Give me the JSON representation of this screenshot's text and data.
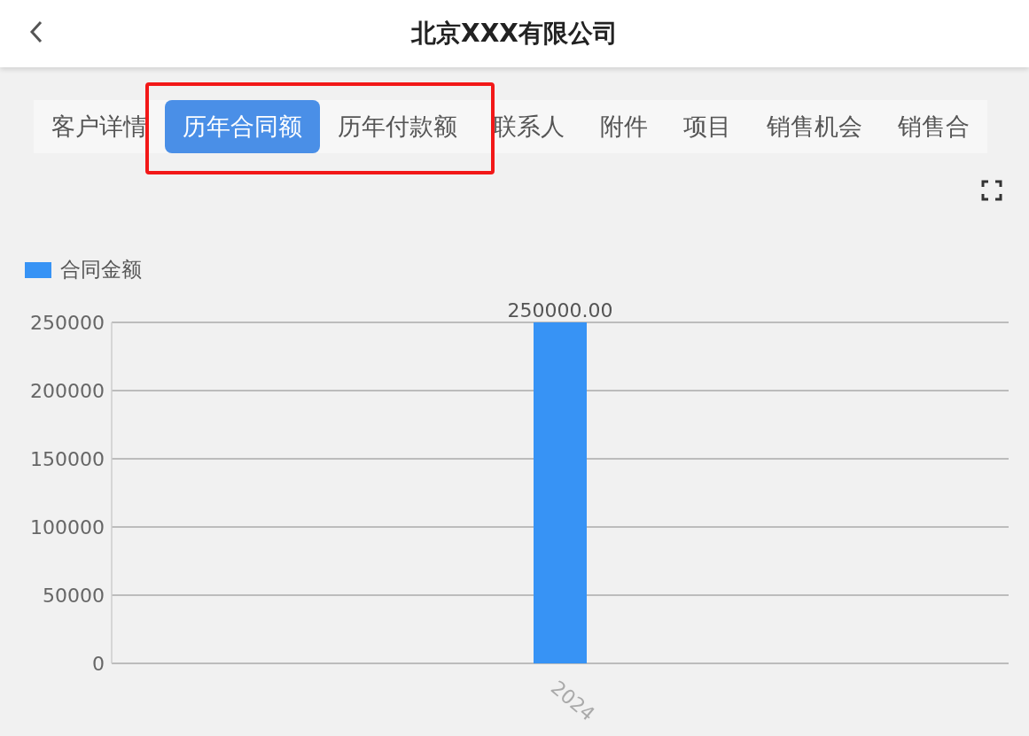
{
  "header": {
    "title": "北京XXX有限公司"
  },
  "tabs": [
    {
      "label": "客户详情",
      "selected": false,
      "highlighted": false
    },
    {
      "label": "历年合同额",
      "selected": true,
      "highlighted": true
    },
    {
      "label": "历年付款额",
      "selected": false,
      "highlighted": true
    },
    {
      "label": "联系人",
      "selected": false,
      "highlighted": false
    },
    {
      "label": "附件",
      "selected": false,
      "highlighted": false
    },
    {
      "label": "项目",
      "selected": false,
      "highlighted": false
    },
    {
      "label": "销售机会",
      "selected": false,
      "highlighted": false
    },
    {
      "label": "销售合",
      "selected": false,
      "highlighted": false
    }
  ],
  "chart": {
    "chart_data": {
      "type": "bar",
      "categories": [
        "2024"
      ],
      "series": [
        {
          "name": "合同金额",
          "color": "#3793f5",
          "values": [
            250000
          ]
        }
      ],
      "ylim": [
        0,
        250000
      ],
      "yticks": [
        0,
        50000,
        100000,
        150000,
        200000,
        250000
      ],
      "grid": true,
      "value_labels": [
        "250000.00"
      ]
    }
  }
}
